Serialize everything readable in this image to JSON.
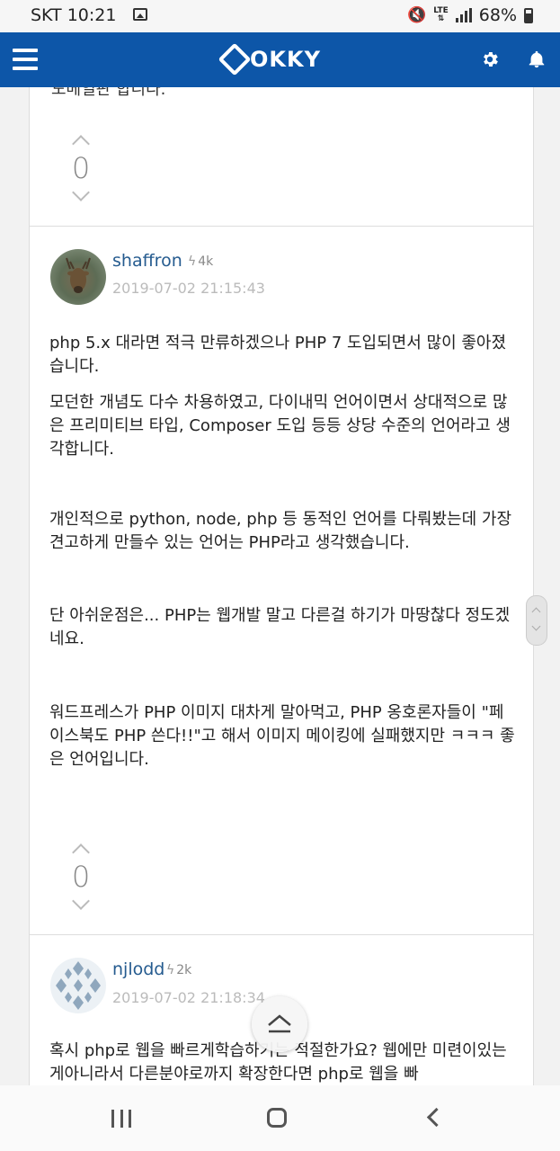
{
  "status_bar": {
    "carrier_time": "SKT 10:21",
    "network": "LTE",
    "battery": "68%"
  },
  "header": {
    "logo_text": "OKKY",
    "brand_color": "#0d56a8"
  },
  "thread": {
    "cut_text": "도메일판 합니다.",
    "top_vote_count": "0",
    "posts": [
      {
        "username": "shaffron",
        "reputation": "4k",
        "date": "2019-07-02 21:15:43",
        "paragraphs": [
          "php 5.x 대라면 적극 만류하겠으나 PHP 7 도입되면서 많이 좋아졌습니다.",
          "모던한 개념도 다수 차용하였고, 다이내믹 언어이면서 상대적으로 많은 프리미티브 타입, Composer 도입 등등 상당 수준의 언어라고 생각합니다.",
          "개인적으로 python, node, php 등 동적인 언어를 다뤄봤는데 가장 견고하게 만들수 있는 언어는 PHP라고 생각했습니다.",
          "단 아쉬운점은... PHP는 웹개발 말고 다른걸 하기가 마땅찮다 정도겠네요.",
          "워드프레스가 PHP 이미지 대차게 말아먹고, PHP 옹호론자들이 \"페이스북도 PHP 쓴다!!\"고 해서 이미지 메이킹에 실패했지만 ㅋㅋㅋ 좋은 언어입니다."
        ],
        "vote_count": "0"
      },
      {
        "username": "njlodd",
        "reputation": "2k",
        "date": "2019-07-02 21:18:34",
        "paragraphs": [
          "혹시 php로 웹을 빠르게학습하기는 적절한가요? 웹에만 미련이있는게아니라서 다른분야로까지 확장한다면 php로 웹을 빠"
        ]
      }
    ]
  }
}
